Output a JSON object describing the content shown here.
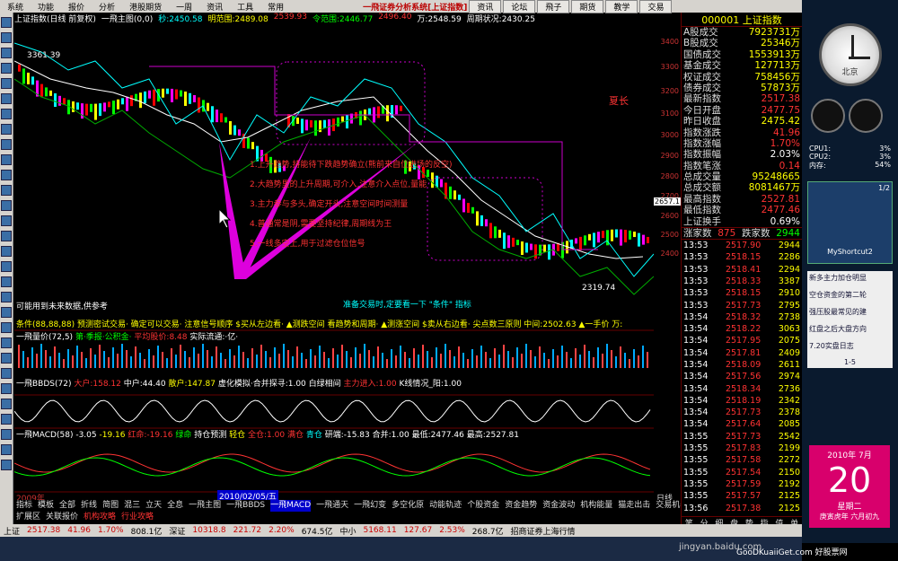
{
  "menu": {
    "items": [
      "系统",
      "功能",
      "报价",
      "分析",
      "港股期货",
      "一周",
      "资讯",
      "工具",
      "常用"
    ],
    "title": "一飛证券分析系统[上证指数]",
    "tabs": [
      "资讯",
      "论坛",
      "飛子",
      "期货",
      "教学",
      "交易"
    ]
  },
  "chart_header": {
    "name": "上证指数(日线 前复权)",
    "ind": "一飛主图(0,0)",
    "i1": "秒:2450.58",
    "i2": "明范围:2489.08",
    "i3": "2539.93",
    "i4": "令范围:2446.77",
    "i5": "2496.40",
    "i6": "万:2548.59",
    "i7": "周期状况:2430.25"
  },
  "price_axis": [
    "3400",
    "3300",
    "3200",
    "3100",
    "3000",
    "2900",
    "2800",
    "2700",
    "2600",
    "2500",
    "2400"
  ],
  "chart_labels": {
    "high": "3361.39",
    "low": "2319.74",
    "current": "2657.1",
    "note_summer": "夏长",
    "hint_bottom": "准备交易时,定要看一下 \"条件\" 指标",
    "disclaimer": "可能用到未来数据,供参考"
  },
  "annotations": [
    "1.上升趋势,持能待下跌趋势确立(熊前来自位进场的反空)",
    "2.大趋势里的上升周期,可介入,注意介入点位,量能",
    "3.主力参与多头,确定开头,注意空间时间测量",
    "4.普通常是阴,需要坚持纪律,周期线为王",
    "5.一线多空上,用于过滤仓位信号"
  ],
  "cond_bar": "条件(88,88,88) 预测密试交易· 确定可以交易· 注意信号顺序 $买从左边看· ▲测跌空间 看趋势和周期· ▲测涨空间 $卖从右边看· 尖点数三原则 中间:2502.63 ▲一手价 万:",
  "vol_panel": {
    "title": "一飛量价(72,5)",
    "extra": "第·季报·公积金·",
    "red": "平均股价:8.48",
    "tail": "实际流通:·亿·"
  },
  "bbd_panel": {
    "title": "一飛BBDS(72)",
    "a": "大户:158.12",
    "b": "中户:44.40",
    "c": "散户:147.87",
    "d": "虚化模拟·合并探寻:1.00",
    "e": "白绿相间",
    "f": "主力进入:1.00",
    "g": "K线情况_阳:1.00"
  },
  "macd_panel": {
    "title": "一飛MACD(58)",
    "a": "-3.05",
    "b": "-19.16",
    "c": "红命:-19.16",
    "d": "绿命",
    "e": "持仓预测",
    "f": "轻仓",
    "g": "全仓:1.00",
    "h": "满仓",
    "i": "青仓",
    "j": "研端:-15.83",
    "k": "合并:1.00",
    "l": "最低:2477.46",
    "m": "最高:2527.81"
  },
  "date_label": "2010/02/05/五",
  "date_left": "2009年",
  "timeframe": "日线",
  "tabs_row1": [
    "指标",
    "模板",
    "全部",
    "折线",
    "简图",
    "混三",
    "立天",
    "全息",
    "一飛主图",
    "一飛BBDS",
    "一飛MACD",
    "一飛通天",
    "一飛幻变",
    "多空化原",
    "动能轨迹",
    "个股资金",
    "资金趋势",
    "资金波动",
    "机构能量",
    "猫走出击",
    "交易机器",
    "筹码压力"
  ],
  "tabs_row2": [
    "扩展区",
    "关联报价",
    "机构攻略",
    "行业攻略"
  ],
  "rp": {
    "code": "000001",
    "name": "上证指数",
    "stats": [
      [
        "A股成交",
        "7923731万"
      ],
      [
        "B股成交",
        "25346万"
      ],
      [
        "国债成交",
        "1553913万"
      ],
      [
        "基金成交",
        "127713万"
      ],
      [
        "权证成交",
        "758456万"
      ],
      [
        "债券成交",
        "57873万"
      ],
      [
        "最新指数",
        "2517.38"
      ],
      [
        "今日开盘",
        "2477.75"
      ],
      [
        "昨日收盘",
        "2475.42"
      ],
      [
        "指数涨跌",
        "41.96"
      ],
      [
        "指数涨幅",
        "1.70%"
      ],
      [
        "指数振幅",
        "2.03%"
      ],
      [
        "指数笔涨",
        "0.14"
      ],
      [
        "总成交量",
        "95248665"
      ],
      [
        "总成交额",
        "8081467万"
      ],
      [
        "最高指数",
        "2527.81"
      ],
      [
        "最低指数",
        "2477.46"
      ],
      [
        "上证换手",
        "0.69%"
      ]
    ],
    "updown": {
      "up_label": "涨家数",
      "up": "875",
      "down_label": "跌家数",
      "down": "2944"
    },
    "ticks": [
      [
        "13:53",
        "2517.90",
        "2944"
      ],
      [
        "13:53",
        "2518.15",
        "2286"
      ],
      [
        "13:53",
        "2518.41",
        "2294"
      ],
      [
        "13:53",
        "2518.33",
        "3387"
      ],
      [
        "13:53",
        "2518.15",
        "2910"
      ],
      [
        "13:53",
        "2517.73",
        "2795"
      ],
      [
        "13:54",
        "2518.32",
        "2738"
      ],
      [
        "13:54",
        "2518.22",
        "3063"
      ],
      [
        "13:54",
        "2517.95",
        "2075"
      ],
      [
        "13:54",
        "2517.81",
        "2409"
      ],
      [
        "13:54",
        "2518.09",
        "2611"
      ],
      [
        "13:54",
        "2517.56",
        "2974"
      ],
      [
        "13:54",
        "2518.34",
        "2736"
      ],
      [
        "13:54",
        "2518.19",
        "2342"
      ],
      [
        "13:54",
        "2517.73",
        "2378"
      ],
      [
        "13:54",
        "2517.64",
        "2085"
      ],
      [
        "13:55",
        "2517.73",
        "2542"
      ],
      [
        "13:55",
        "2517.83",
        "2199"
      ],
      [
        "13:55",
        "2517.58",
        "2272"
      ],
      [
        "13:55",
        "2517.54",
        "2150"
      ],
      [
        "13:55",
        "2517.59",
        "2192"
      ],
      [
        "13:55",
        "2517.57",
        "2125"
      ],
      [
        "13:56",
        "2517.38",
        "2125"
      ]
    ],
    "bottom": [
      "笔",
      "分",
      "细",
      "盘",
      "势",
      "指",
      "值",
      "单"
    ]
  },
  "status": {
    "a": "上证",
    "b": "2517.38",
    "c": "41.96",
    "d": "1.70%",
    "e": "808.1亿",
    "f": "深证",
    "g": "10318.8",
    "h": "221.72",
    "i": "2.20%",
    "j": "674.5亿",
    "k": "中小",
    "l": "5168.11",
    "m": "127.67",
    "n": "2.53%",
    "o": "268.7亿",
    "p": "招商证券上海行情"
  },
  "widgets": {
    "clock_label": "北京",
    "cpu1": "CPU1:",
    "cpu1v": "3%",
    "cpu2": "CPU2:",
    "cpu2v": "3%",
    "mem": "内存:",
    "memv": "54%",
    "shortcut": "MyShortcut2",
    "page": "1/2",
    "news": [
      "新多主力加仓明显",
      "空仓资金的第二轮",
      "强压股最常见的建",
      "红盘之后大盘方向",
      "7.20实盘日志"
    ],
    "pager": "1-5",
    "cal_month": "2010年 7月",
    "cal_day": "20",
    "cal_week": "星期二",
    "cal_lunar": "庚寅虎年 六月初九"
  },
  "watermark": "jingyan.baidu.com",
  "site": "GooDKuaiiGet.com 好股票网"
}
